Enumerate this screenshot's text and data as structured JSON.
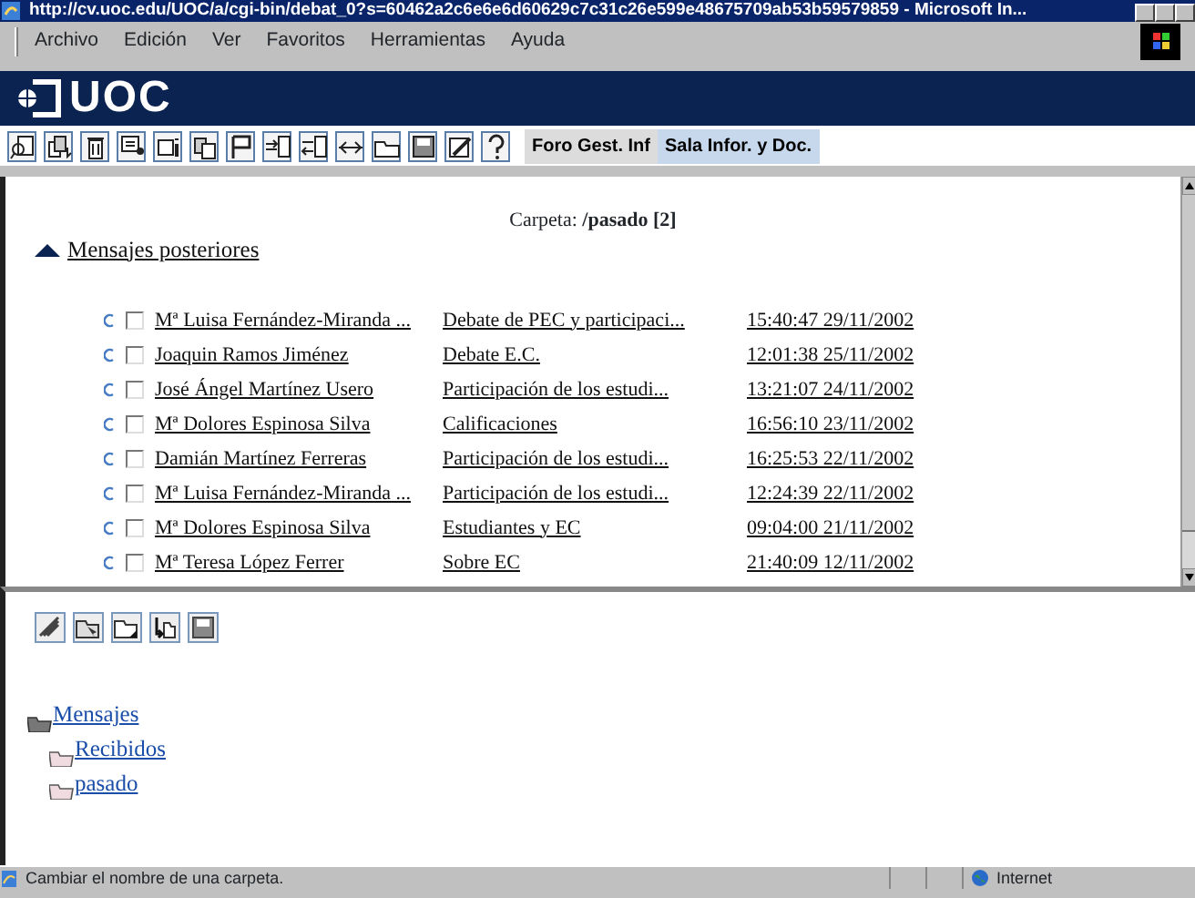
{
  "window": {
    "title": "http://cv.uoc.edu/UOC/a/cgi-bin/debat_0?s=60462a2c6e6e6d60629c7c31c26e599e48675709ab53b59579859 - Microsoft In..."
  },
  "menu": [
    "Archivo",
    "Edición",
    "Ver",
    "Favoritos",
    "Herramientas",
    "Ayuda"
  ],
  "banner": {
    "logo": "UOC"
  },
  "tabs": [
    {
      "label": "Foro Gest. Inf",
      "selected": false
    },
    {
      "label": "Sala Infor. y Doc.",
      "selected": true
    }
  ],
  "folder_header": {
    "label": "Carpeta: ",
    "name": "/pasado [2]"
  },
  "previous_link": "Mensajes posteriores",
  "messages": [
    {
      "checked": false,
      "author": "Mª Luisa Fernández-Miranda ...",
      "subject": "Debate de PEC y participaci...",
      "date": "15:40:47 29/11/2002"
    },
    {
      "checked": false,
      "author": "Joaquin Ramos Jiménez",
      "subject": "Debate E.C.",
      "date": "12:01:38 25/11/2002"
    },
    {
      "checked": false,
      "author": "José Ángel Martínez Usero",
      "subject": "Participación de los estudi...",
      "date": "13:21:07 24/11/2002"
    },
    {
      "checked": false,
      "author": "Mª Dolores Espinosa Silva",
      "subject": "Calificaciones",
      "date": "16:56:10 23/11/2002"
    },
    {
      "checked": false,
      "author": "Damián Martínez Ferreras",
      "subject": "Participación de los estudi...",
      "date": "16:25:53 22/11/2002"
    },
    {
      "checked": false,
      "author": "Mª Luisa Fernández-Miranda ...",
      "subject": "Participación de los estudi...",
      "date": "12:24:39 22/11/2002"
    },
    {
      "checked": false,
      "author": "Mª Dolores Espinosa Silva",
      "subject": "Estudiantes y EC",
      "date": "09:04:00 21/11/2002"
    },
    {
      "checked": false,
      "author": "Mª Teresa López Ferrer",
      "subject": "Sobre EC",
      "date": "21:40:09 12/11/2002"
    }
  ],
  "folder_tree": [
    {
      "label": "Mensajes",
      "children": [
        {
          "label": "Recibidos"
        },
        {
          "label": "pasado"
        }
      ]
    }
  ],
  "status_bar": {
    "text": "Cambiar el nombre de una carpeta.",
    "zone": "Internet"
  }
}
